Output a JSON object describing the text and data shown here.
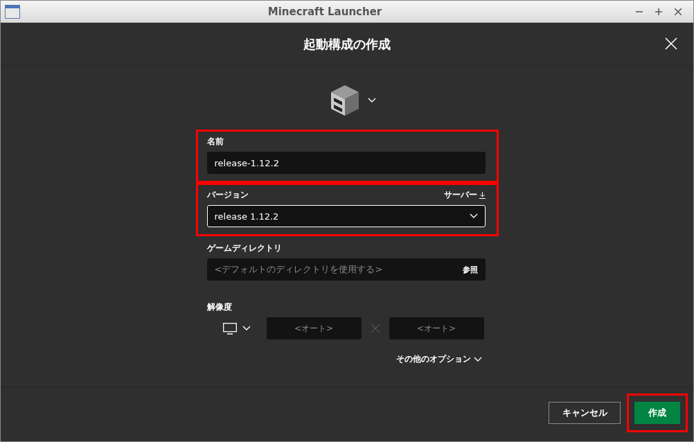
{
  "window": {
    "title": "Minecraft Launcher"
  },
  "dialog": {
    "title": "起動構成の作成"
  },
  "fields": [
    {
      "kind": "text",
      "label": "名前",
      "value": "release-1.12.2",
      "highlighted": true
    },
    {
      "kind": "select",
      "label": "バージョン",
      "side_link": "サーバー",
      "value": "release 1.12.2",
      "focused": true,
      "highlighted": true
    },
    {
      "kind": "browse",
      "label": "ゲームディレクトリ",
      "placeholder": "<デフォルトのディレクトリを使用する>",
      "button": "参照",
      "highlighted": false
    }
  ],
  "resolution": {
    "label": "解像度",
    "width_placeholder": "<オート>",
    "height_placeholder": "<オート>"
  },
  "more_options": "その他のオプション",
  "buttons": [
    {
      "kind": "secondary",
      "label": "キャンセル",
      "highlighted": false
    },
    {
      "kind": "primary",
      "label": "作成",
      "highlighted": true
    }
  ]
}
